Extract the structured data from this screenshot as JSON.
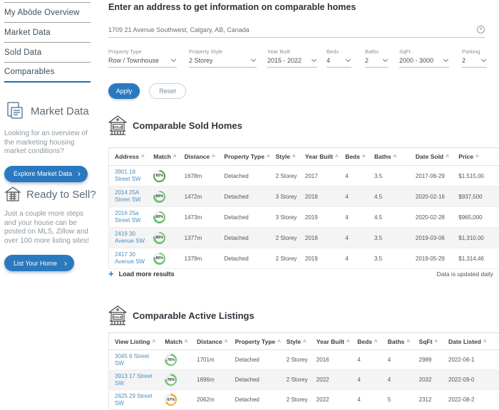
{
  "colors": {
    "accent_blue": "#2a79bf",
    "link_blue": "#4a8fc0",
    "nav_active_blue": "#1c6fb5",
    "green_strong": "#3ca93f",
    "green": "#6ec571",
    "orange": "#eda93c"
  },
  "sidebar": {
    "nav": [
      {
        "label": "My Abōde Overview",
        "active": false
      },
      {
        "label": "Market Data",
        "active": false
      },
      {
        "label": "Sold Data",
        "active": false
      },
      {
        "label": "Comparables",
        "active": true
      }
    ],
    "market_promo": {
      "title": "Market Data",
      "text": "Looking for an overview of the marketing housing market conditions?",
      "button": "Explore Market Data",
      "arrow": "›"
    },
    "sell_promo": {
      "title": "Ready to Sell?",
      "text": "Just a couple more steps and your house can be posted on MLS, Zillow and over 100 more listing sites!",
      "button": "List Your Home",
      "arrow": "›"
    }
  },
  "main": {
    "heading": "Enter an address to get information on comparable homes",
    "address_input": {
      "value": "1709 21 Avenue Southwest, Calgary, AB, Canada",
      "clear_glyph": "×"
    },
    "filters": [
      {
        "label": "Property Type",
        "value": "Row / Townhouse"
      },
      {
        "label": "Property Style",
        "value": "2 Storey"
      },
      {
        "label": "Year Built",
        "value": "2015 - 2022"
      },
      {
        "label": "Beds",
        "value": "4"
      },
      {
        "label": "Baths",
        "value": "2"
      },
      {
        "label": "SqFt",
        "value": "2000 - 3000"
      },
      {
        "label": "Parking",
        "value": "2"
      }
    ],
    "apply_label": "Apply",
    "reset_label": "Reset",
    "sold_section": {
      "icon_label": "SOLD",
      "title": "Comparable Sold Homes",
      "sort_glyph": "^",
      "columns": [
        "Address",
        "Match",
        "Distance",
        "Property Type",
        "Style",
        "Year Built",
        "Beds",
        "Baths",
        "Date Sold",
        "Price"
      ],
      "rows": [
        {
          "address": "3901 18 Street SW",
          "match": "82%",
          "distance": "1678m",
          "property_type": "Detached",
          "style": "2 Storey",
          "year_built": "2017",
          "beds": "4",
          "baths": "3.5",
          "date_sold": "2017-06-29",
          "price": "$1,515,00",
          "ring_color": "#3ca93f",
          "strong": true
        },
        {
          "address": "2014 25A Street SW",
          "match": "80%",
          "distance": "1472m",
          "property_type": "Detached",
          "style": "3 Storey",
          "year_built": "2018",
          "beds": "4",
          "baths": "4.5",
          "date_sold": "2020-02-16",
          "price": "$937,500",
          "ring_color": "#6ec571",
          "strong": false
        },
        {
          "address": "2016 25a Street SW",
          "match": "80%",
          "distance": "1473m",
          "property_type": "Detached",
          "style": "3 Storey",
          "year_built": "2019",
          "beds": "4",
          "baths": "4.5",
          "date_sold": "2020-02-28",
          "price": "$965,000",
          "ring_color": "#6ec571",
          "strong": false
        },
        {
          "address": "2419 30 Avenue SW",
          "match": "80%",
          "distance": "1377m",
          "property_type": "Detached",
          "style": "2 Storey",
          "year_built": "2018",
          "beds": "4",
          "baths": "3.5",
          "date_sold": "2019-03-06",
          "price": "$1,310,00",
          "ring_color": "#6ec571",
          "strong": false
        },
        {
          "address": "2417 30 Avenue SW",
          "match": "80%",
          "distance": "1379m",
          "property_type": "Detached",
          "style": "2 Storey",
          "year_built": "2019",
          "beds": "4",
          "baths": "3.5",
          "date_sold": "2019-05-29",
          "price": "$1,314,46",
          "ring_color": "#6ec571",
          "strong": false
        }
      ],
      "load_more": "Load more results",
      "plus_glyph": "+",
      "updated_note": "Data is updated daily"
    },
    "active_section": {
      "icon_label": "SALE",
      "title": "Comparable Active Listings",
      "sort_glyph": "^",
      "columns": [
        "View Listing",
        "Match",
        "Distance",
        "Property Type",
        "Style",
        "Year Built",
        "Beds",
        "Baths",
        "SqFt",
        "Date Listed"
      ],
      "rows": [
        {
          "view_listing": "3045 6 Street SW",
          "match": "76%",
          "distance": "1701m",
          "property_type": "Detached",
          "style": "2 Storey",
          "year_built": "2016",
          "beds": "4",
          "baths": "4",
          "sqft": "2989",
          "date_listed": "2022-06-1",
          "ring_color": "#6ec571",
          "strong": false
        },
        {
          "view_listing": "3913 17 Street SW",
          "match": "76%",
          "distance": "1696m",
          "property_type": "Detached",
          "style": "2 Storey",
          "year_built": "2022",
          "beds": "4",
          "baths": "4",
          "sqft": "2032",
          "date_listed": "2022-09-0",
          "ring_color": "#6ec571",
          "strong": false
        },
        {
          "view_listing": "2625 29 Street SW",
          "match": "67%",
          "distance": "2062m",
          "property_type": "Detached",
          "style": "2 Storey",
          "year_built": "2022",
          "beds": "4",
          "baths": "5",
          "sqft": "2312",
          "date_listed": "2022-08-2",
          "ring_color": "#eda93c",
          "strong": false
        }
      ]
    }
  }
}
